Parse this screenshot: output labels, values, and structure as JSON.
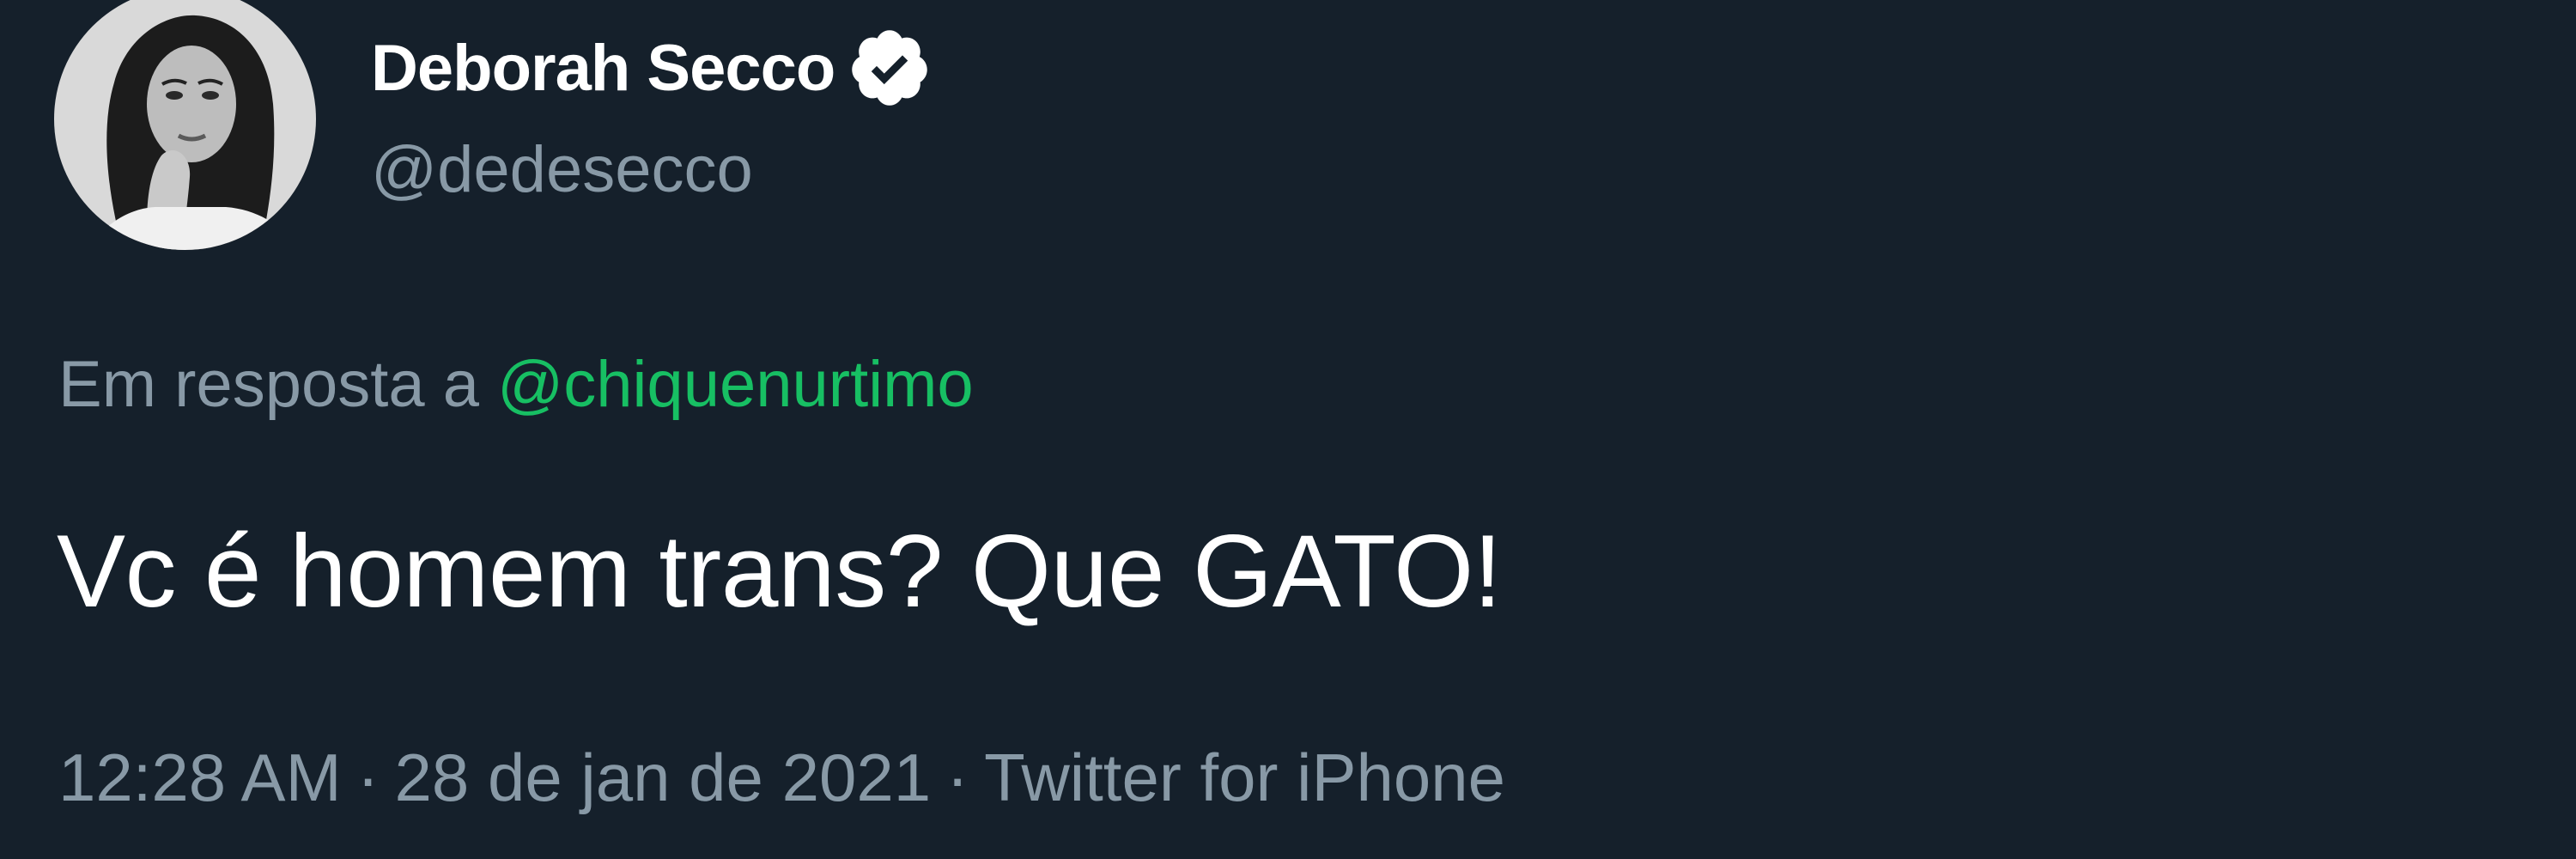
{
  "author": {
    "display_name": "Deborah Secco",
    "handle": "@dedesecco",
    "verified_icon": "verified-badge-icon",
    "avatar": "profile-photo"
  },
  "reply": {
    "prefix": "Em resposta a",
    "to_handle": "@chiquenurtimo"
  },
  "tweet": {
    "text": "Vc é homem trans? Que GATO!"
  },
  "meta": {
    "time": "12:28 AM",
    "separator": "·",
    "date": "28 de jan de 2021",
    "source": "Twitter for iPhone"
  },
  "colors": {
    "background": "#15202b",
    "primary_text": "#ffffff",
    "secondary_text": "#8899a6",
    "mention": "#17bf63"
  }
}
